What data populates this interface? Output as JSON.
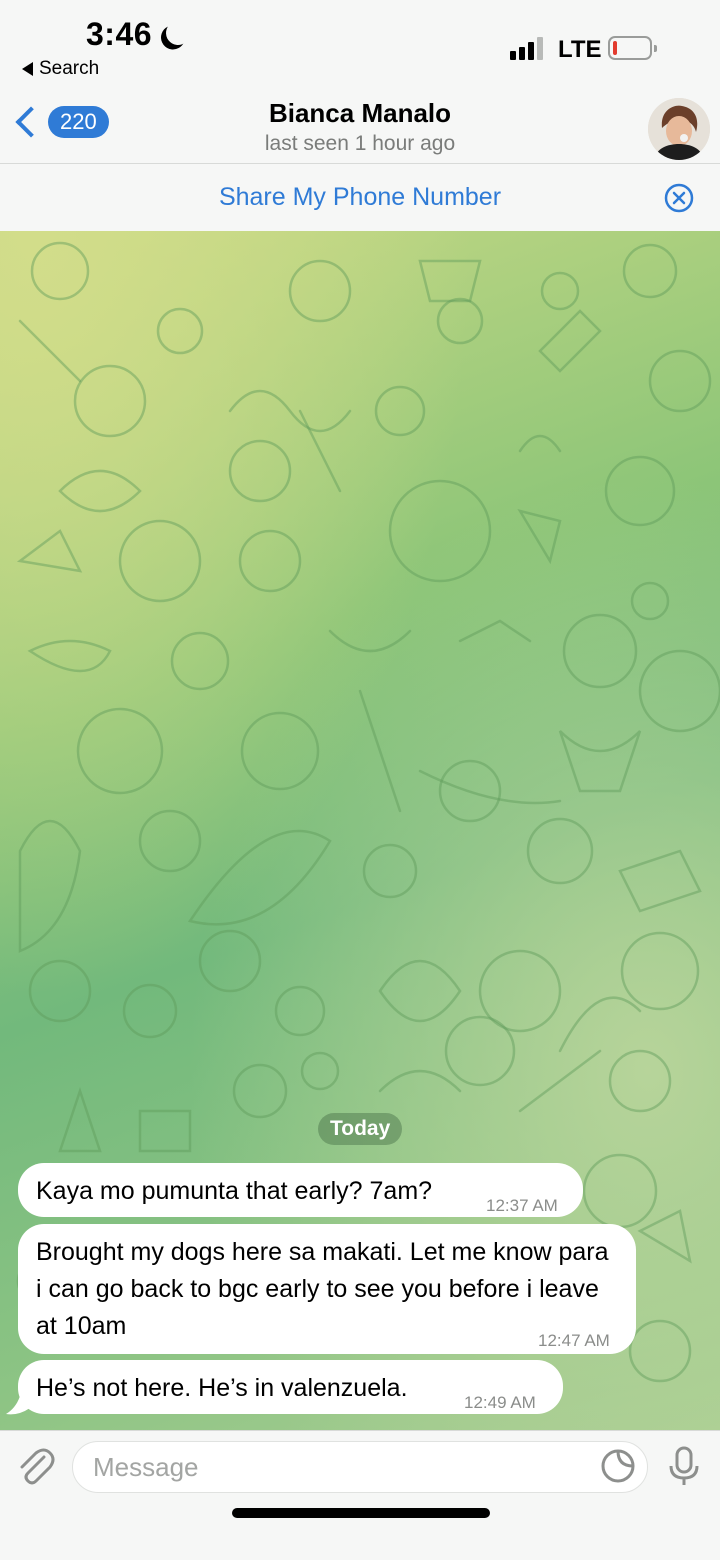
{
  "status_bar": {
    "time": "3:46",
    "back_app": "Search",
    "network": "LTE"
  },
  "header": {
    "back_count": "220",
    "name": "Bianca Manalo",
    "last_seen": "last seen 1 hour ago"
  },
  "share_bar": {
    "label": "Share My Phone Number"
  },
  "chat": {
    "date_label": "Today",
    "messages": [
      {
        "text": "Kaya mo pumunta that early? 7am?",
        "time": "12:37 AM"
      },
      {
        "text": "Brought my dogs here sa makati. Let me know para i can go back to bgc early to see you before i leave at 10am",
        "time": "12:47 AM"
      },
      {
        "text": "He’s not here. He’s in valenzuela.",
        "time": "12:49 AM"
      }
    ]
  },
  "input": {
    "placeholder": "Message"
  },
  "colors": {
    "accent": "#2f7bd6",
    "bubble": "#ffffff",
    "chat_bg": "#8cc578"
  }
}
